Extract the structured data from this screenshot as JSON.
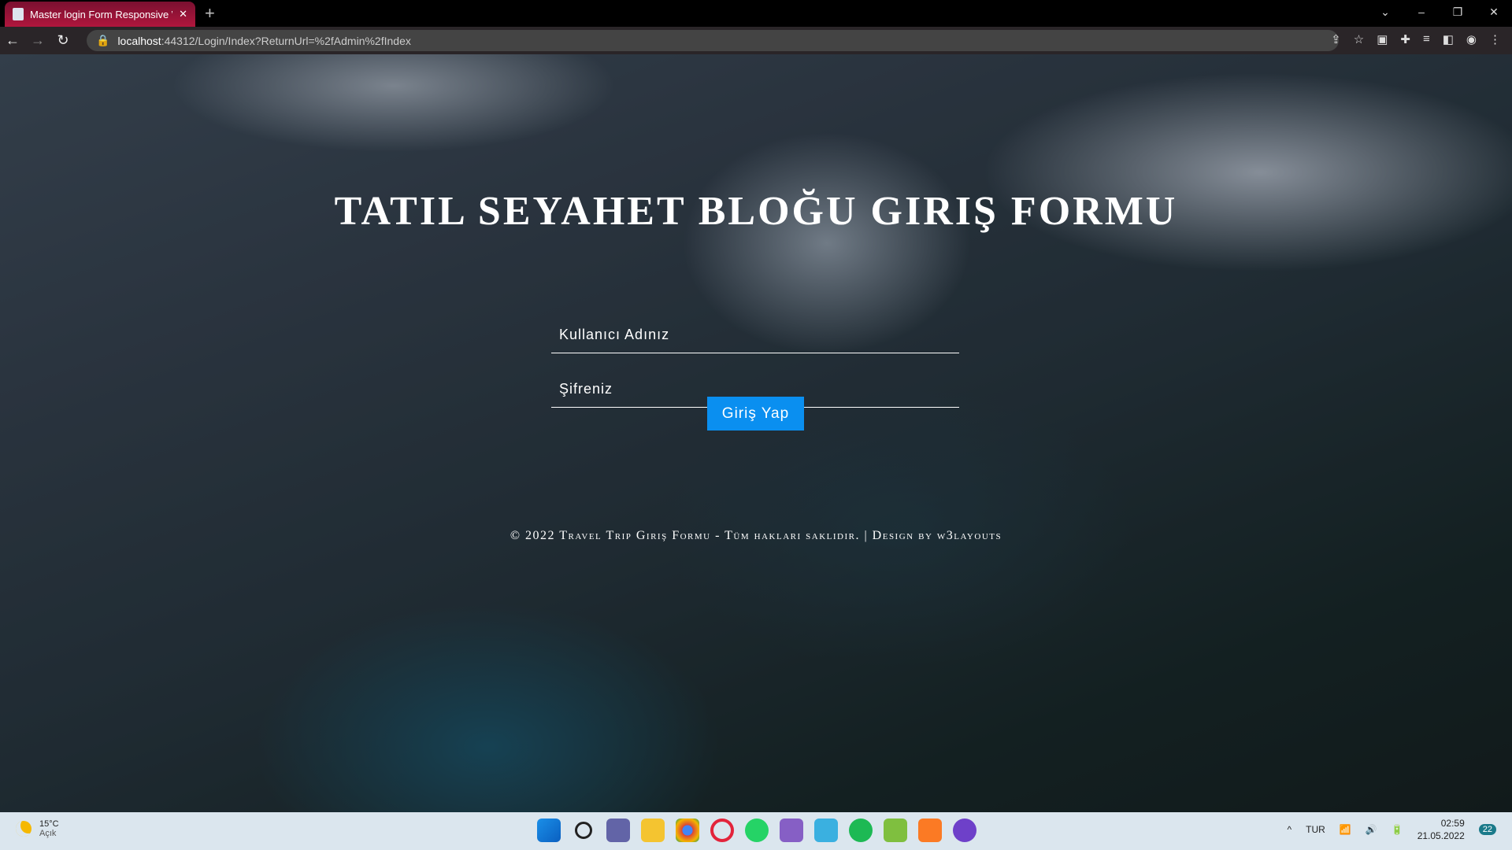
{
  "browser": {
    "tab_title": "Master login Form Responsive W",
    "url_host": "localhost",
    "url_rest": ":44312/Login/Index?ReturnUrl=%2fAdmin%2fIndex"
  },
  "page": {
    "title": "Tatil Seyahet Bloğu Giriş Formu",
    "username_placeholder": "Kullanıcı Adınız",
    "password_placeholder": "Şifreniz",
    "login_button": "Giriş Yap",
    "footer": "© 2022 Travel Trip Giriş Formu - Tüm hakları saklıdır. | Design by w3layouts",
    "button_color": "#0a8ff0"
  },
  "taskbar": {
    "temperature": "15°C",
    "weather": "Açık",
    "language": "TUR",
    "time": "02:59",
    "date": "21.05.2022",
    "notifications": "22",
    "apps": [
      "start",
      "search",
      "teams",
      "explorer",
      "chrome",
      "opera",
      "whatsapp",
      "visual-studio",
      "snipping-tool",
      "spotify",
      "notepad",
      "xampp",
      "github-desktop"
    ]
  }
}
